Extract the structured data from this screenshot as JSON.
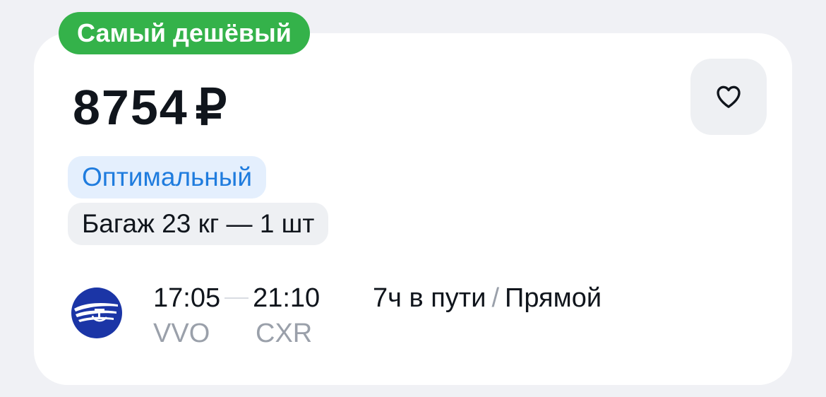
{
  "badge": {
    "label": "Самый дешёвый",
    "color": "#34b24a"
  },
  "price": {
    "amount": "8754",
    "currency": "₽"
  },
  "favorite": {
    "icon": "heart-outline-icon"
  },
  "tags": {
    "tariff": "Оптимальный",
    "baggage": "Багаж 23 кг — 1 шт"
  },
  "flight": {
    "airline_logo": "airline-logo-icon",
    "departure_time": "17:05",
    "arrival_time": "21:10",
    "departure_iata": "VVO",
    "arrival_iata": "CXR",
    "duration": "7ч в пути",
    "separator": "/",
    "stops": "Прямой"
  },
  "colors": {
    "accent_blue": "#1f7cde",
    "text_primary": "#10151c",
    "text_secondary": "#9aa0aa",
    "logo_blue": "#1b35a6"
  }
}
